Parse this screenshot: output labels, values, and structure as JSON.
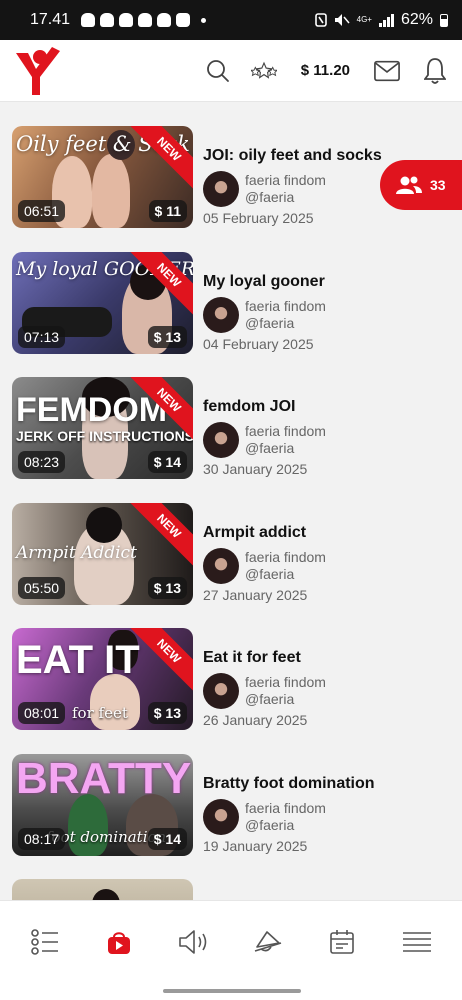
{
  "status_bar": {
    "time": "17.41",
    "battery": "62%",
    "network": "4G+"
  },
  "header": {
    "balance": "$ 11.20"
  },
  "followers": {
    "count": "33"
  },
  "videos": [
    {
      "title": "JOI: oily feet and socks",
      "author": "faeria findom",
      "handle": "@faeria",
      "date": "05 February 2025",
      "duration": "06:51",
      "price": "$ 11",
      "badge": "NEW",
      "thumb_text": "Oily feet & Sock JOI",
      "thumb_sub": ""
    },
    {
      "title": "My loyal gooner",
      "author": "faeria findom",
      "handle": "@faeria",
      "date": "04 February 2025",
      "duration": "07:13",
      "price": "$ 13",
      "badge": "NEW",
      "thumb_text": "My loyal GOONER",
      "thumb_sub": ""
    },
    {
      "title": "femdom JOI",
      "author": "faeria findom",
      "handle": "@faeria",
      "date": "30 January 2025",
      "duration": "08:23",
      "price": "$ 14",
      "badge": "NEW",
      "thumb_text": "FEMDOM",
      "thumb_sub": "JERK OFF INSTRUCTIONS"
    },
    {
      "title": "Armpit addict",
      "author": "faeria findom",
      "handle": "@faeria",
      "date": "27 January 2025",
      "duration": "05:50",
      "price": "$ 13",
      "badge": "NEW",
      "thumb_text": "Armpit Addict",
      "thumb_sub": ""
    },
    {
      "title": "Eat it for feet",
      "author": "faeria findom",
      "handle": "@faeria",
      "date": "26 January 2025",
      "duration": "08:01",
      "price": "$ 13",
      "badge": "NEW",
      "thumb_text": "EAT IT",
      "thumb_sub": "for feet"
    },
    {
      "title": "Bratty foot domination",
      "author": "faeria findom",
      "handle": "@faeria",
      "date": "19 January 2025",
      "duration": "08:17",
      "price": "$ 14",
      "badge": "",
      "thumb_text": "BRATTY",
      "thumb_sub": "foot domination"
    }
  ],
  "colors": {
    "accent": "#e0141e",
    "background": "#f2f2f2",
    "text": "#111111",
    "muted": "#666666"
  },
  "bottom_nav": [
    {
      "name": "list",
      "icon": "list-icon"
    },
    {
      "name": "videos",
      "icon": "video-bag-icon",
      "active": true
    },
    {
      "name": "audio",
      "icon": "speaker-icon"
    },
    {
      "name": "tips",
      "icon": "bell-cone-icon"
    },
    {
      "name": "calendar",
      "icon": "calendar-icon"
    },
    {
      "name": "menu",
      "icon": "menu-icon"
    }
  ]
}
